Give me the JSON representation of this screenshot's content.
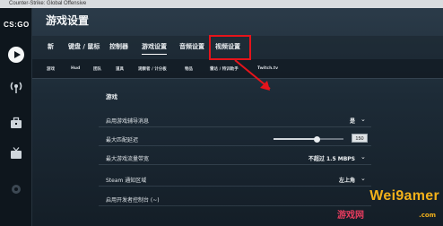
{
  "window": {
    "title": "Counter-Strike: Global Offensive"
  },
  "sidebar": {
    "logo": "CS:GO"
  },
  "page": {
    "title": "游戏设置"
  },
  "tabs": [
    {
      "label": "新"
    },
    {
      "label": "键盘 / 鼠标"
    },
    {
      "label": "控制器"
    },
    {
      "label": "游戏设置"
    },
    {
      "label": "音频设置"
    },
    {
      "label": "视频设置"
    }
  ],
  "subtabs": [
    {
      "label": "游戏"
    },
    {
      "label": "Hud"
    },
    {
      "label": "团队"
    },
    {
      "label": "道具"
    },
    {
      "label": "观察者 / 计分板"
    },
    {
      "label": "物品"
    },
    {
      "label": "雷达 / 特训助手"
    },
    {
      "label": "Twitch.tv"
    }
  ],
  "section": {
    "title": "游戏"
  },
  "settings": [
    {
      "label": "启用游戏辅导消息",
      "value": "是"
    },
    {
      "label": "最大匹配延迟",
      "value": "150",
      "slider_fraction": 0.62
    },
    {
      "label": "最大游戏流量带宽",
      "value": "不超过 1.5 MBPS"
    },
    {
      "label": "Steam 通知区域",
      "value": "左上角"
    },
    {
      "label": "启用开发者控制台 (~)",
      "value": ""
    }
  ],
  "watermark": {
    "brand": "Wei9amer",
    "sub": "游戏网",
    "domain": ".com"
  },
  "colors": {
    "highlight": "#e5141b",
    "watermark": "#f3b11a"
  }
}
